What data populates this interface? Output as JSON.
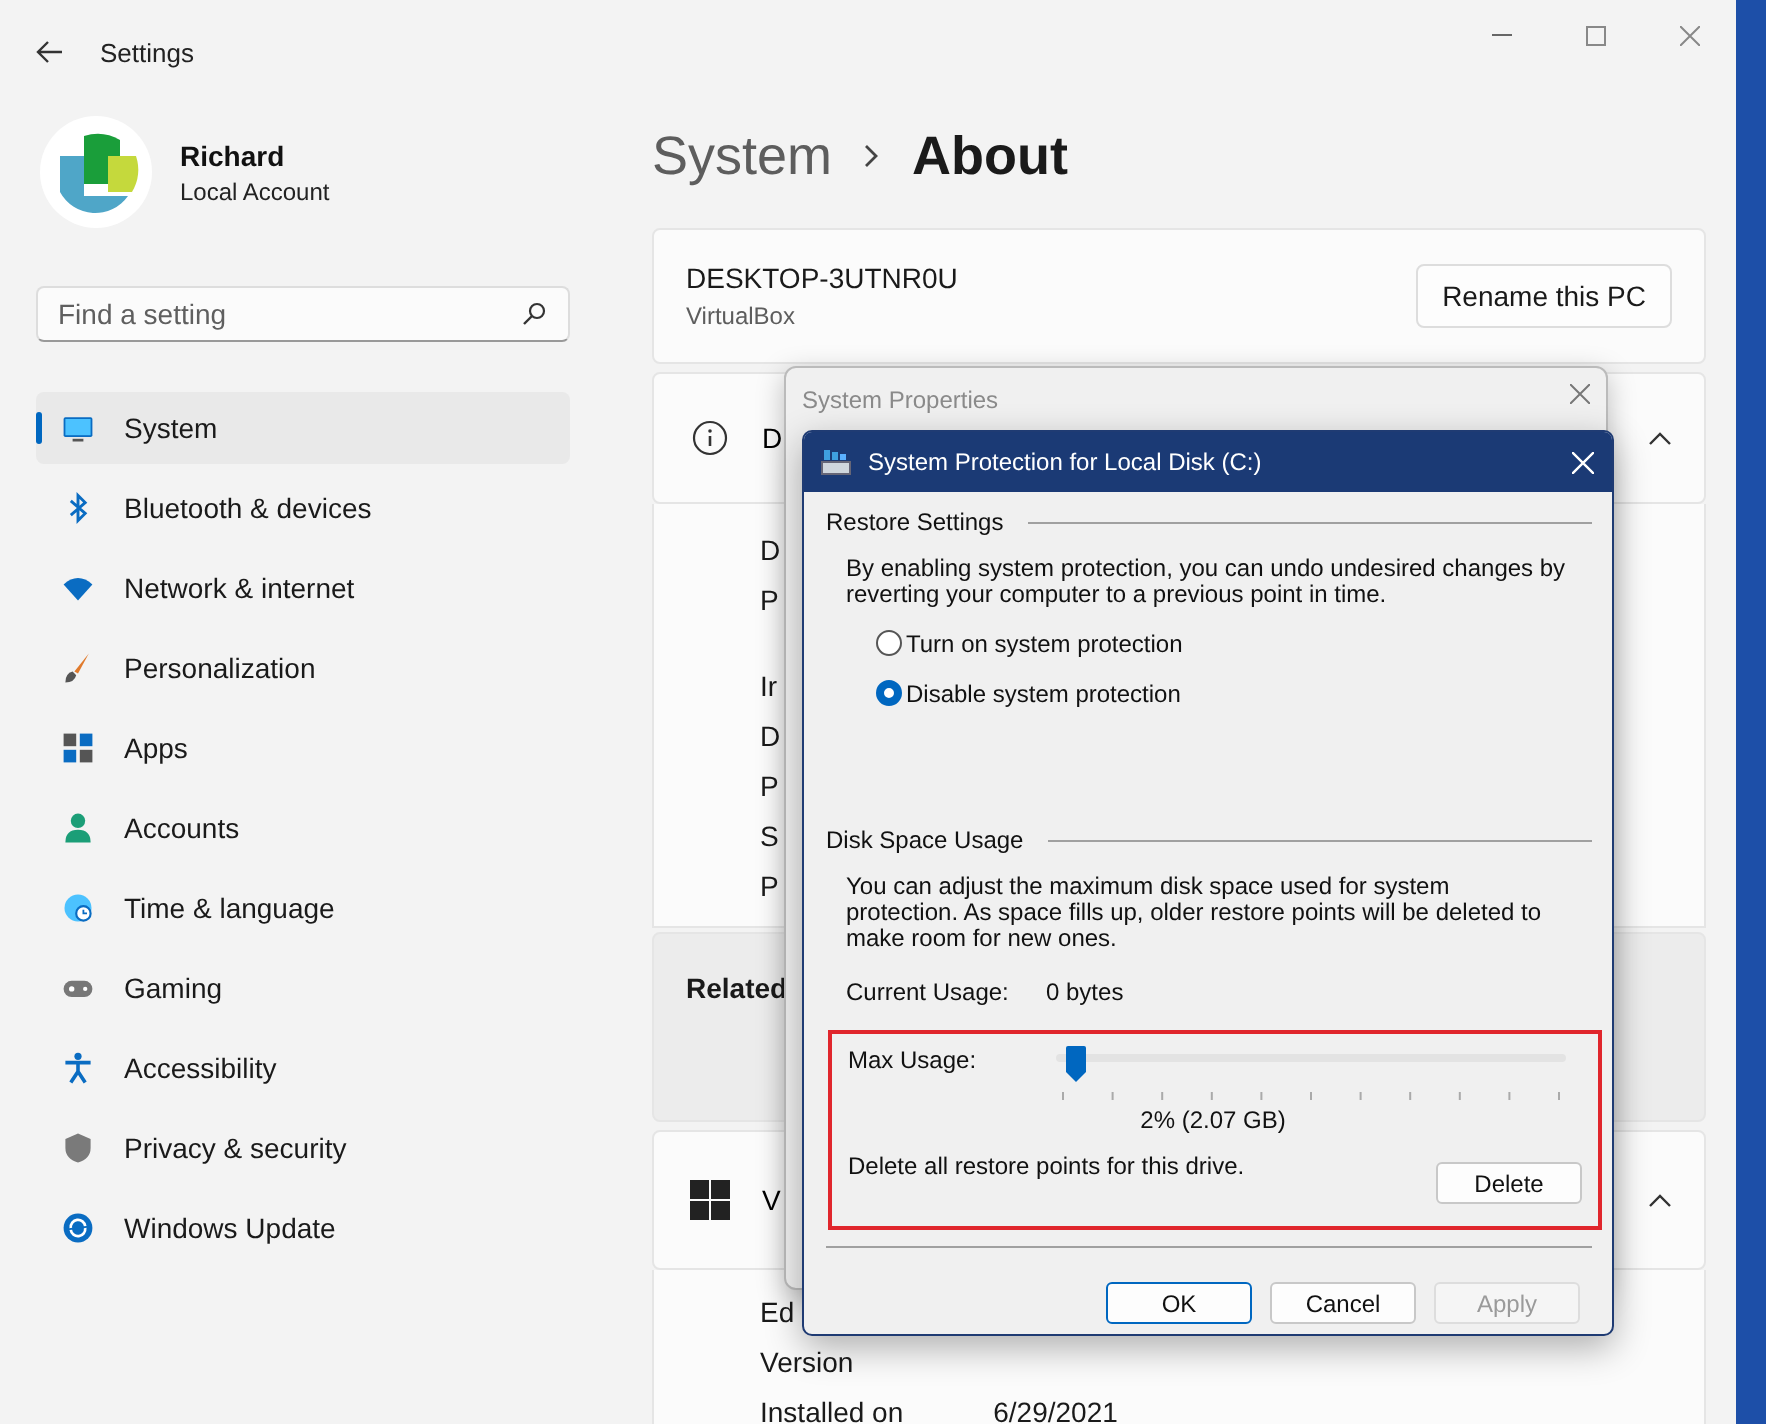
{
  "window": {
    "title": "Settings"
  },
  "account": {
    "name": "Richard",
    "type": "Local Account"
  },
  "search": {
    "placeholder": "Find a setting"
  },
  "nav": [
    {
      "label": "System",
      "selected": true
    },
    {
      "label": "Bluetooth & devices",
      "selected": false
    },
    {
      "label": "Network & internet",
      "selected": false
    },
    {
      "label": "Personalization",
      "selected": false
    },
    {
      "label": "Apps",
      "selected": false
    },
    {
      "label": "Accounts",
      "selected": false
    },
    {
      "label": "Time & language",
      "selected": false
    },
    {
      "label": "Gaming",
      "selected": false
    },
    {
      "label": "Accessibility",
      "selected": false
    },
    {
      "label": "Privacy & security",
      "selected": false
    },
    {
      "label": "Windows Update",
      "selected": false
    }
  ],
  "breadcrumb": {
    "parent": "System",
    "current": "About"
  },
  "pc": {
    "name": "DESKTOP-3UTNR0U",
    "model": "VirtualBox",
    "rename_button": "Rename this PC"
  },
  "device_specs": {
    "title": "D",
    "expanded": true,
    "rows": [
      {
        "label": "D"
      },
      {
        "label": "P"
      },
      {
        "label": "Ir"
      },
      {
        "label": "D"
      },
      {
        "label": "P"
      },
      {
        "label": "S"
      },
      {
        "label": "P"
      }
    ]
  },
  "related": {
    "title": "Related"
  },
  "windows_specs": {
    "title": "V",
    "expanded": true,
    "rows": [
      {
        "label": "Ed"
      },
      {
        "label": "Version"
      },
      {
        "label": "Installed on",
        "value": "6/29/2021"
      }
    ]
  },
  "system_properties": {
    "title": "System Properties"
  },
  "protection_dialog": {
    "title": "System Protection for Local Disk (C:)",
    "restore_settings": {
      "heading": "Restore Settings",
      "description": "By enabling system protection, you can undo undesired changes by reverting your computer to a previous point in time.",
      "options": [
        {
          "label": "Turn on system protection",
          "selected": false
        },
        {
          "label": "Disable system protection",
          "selected": true
        }
      ]
    },
    "disk_space": {
      "heading": "Disk Space Usage",
      "description": "You can adjust the maximum disk space used for system protection. As space fills up, older restore points will be deleted to make room for new ones.",
      "current_usage_label": "Current Usage:",
      "current_usage": "0 bytes",
      "max_usage_label": "Max Usage:",
      "level": 0.02,
      "max_usage_reading": "2% (2.07 GB)",
      "delete_text": "Delete all restore points for this drive.",
      "delete_button": "Delete"
    },
    "buttons": [
      {
        "label": "OK",
        "kind": "default"
      },
      {
        "label": "Cancel",
        "kind": "normal"
      },
      {
        "label": "Apply",
        "kind": "disabled"
      }
    ]
  }
}
